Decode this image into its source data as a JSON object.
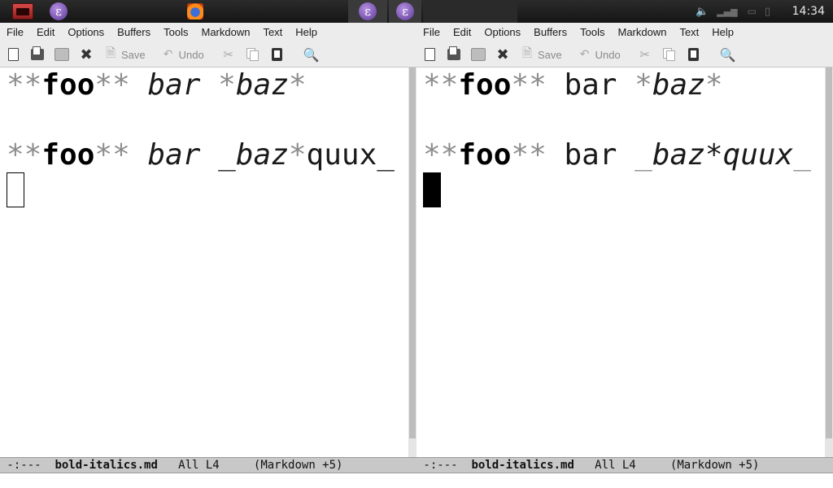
{
  "taskbar": {
    "clock": "14:34",
    "tasks": [
      {
        "name": "terminal",
        "icon": "terminal-icon"
      },
      {
        "name": "emacs",
        "icon": "emacs-icon"
      },
      {
        "name": "firefox",
        "icon": "firefox-icon"
      },
      {
        "name": "emacs-window-1",
        "icon": "emacs-icon"
      },
      {
        "name": "emacs-window-2",
        "icon": "emacs-icon"
      }
    ],
    "tray_icons": [
      "volume-icon",
      "network-icon",
      "battery-icon",
      "clipboard-icon"
    ]
  },
  "menu": {
    "items": [
      "File",
      "Edit",
      "Options",
      "Buffers",
      "Tools",
      "Markdown",
      "Text",
      "Help"
    ]
  },
  "toolbar": {
    "save_label": "Save",
    "undo_label": "Undo"
  },
  "frames": [
    {
      "buffer": {
        "line1": {
          "s1": "**",
          "s2": "foo",
          "s3": "**",
          "s4": " ",
          "s5": "bar",
          "s6": " ",
          "s7": "*",
          "s8": "baz",
          "s9": "*"
        },
        "line2": {
          "s1": "**",
          "s2": "foo",
          "s3": "**",
          "s4": " ",
          "s5": "bar",
          "s6": " ",
          "s7": "_baz",
          "s8": "*",
          "s9": "quux_"
        }
      },
      "cursor_style": "hollow",
      "modeline": {
        "prefix": " -:---  ",
        "bufname": "bold-italics.md",
        "pos": "   All L4     ",
        "mode": "(Markdown +5)"
      }
    },
    {
      "buffer": {
        "line1": {
          "s1": "**",
          "s2": "foo",
          "s3": "**",
          "s4": " ",
          "s5": "bar",
          "s6": " ",
          "s7": "*",
          "s8": "baz",
          "s9": "*"
        },
        "line2": {
          "s1": "**",
          "s2": "foo",
          "s3": "**",
          "s4": " ",
          "s5": "bar",
          "s6": " ",
          "s7": "_",
          "s8": "baz*quux",
          "s9": "_"
        }
      },
      "cursor_style": "solid",
      "modeline": {
        "prefix": " -:---  ",
        "bufname": "bold-italics.md",
        "pos": "   All L4     ",
        "mode": "(Markdown +5)"
      }
    }
  ],
  "colors": {
    "markup": "#8c8c8c",
    "text": "#1a1a1a",
    "panel": "#1f1f1f",
    "modeline": "#c8c8c8"
  }
}
